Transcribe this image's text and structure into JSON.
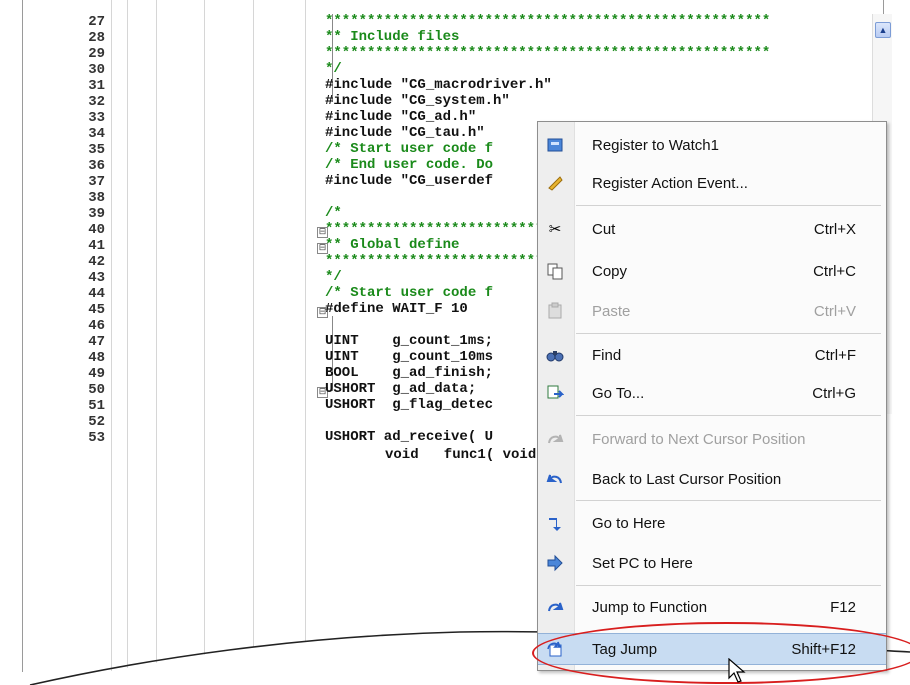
{
  "editor": {
    "line_numbers": [
      "27",
      "28",
      "29",
      "30",
      "31",
      "32",
      "33",
      "34",
      "35",
      "36",
      "37",
      "38",
      "39",
      "40",
      "41",
      "42",
      "43",
      "44",
      "45",
      "46",
      "47",
      "48",
      "49",
      "50",
      "51",
      "52",
      "53"
    ],
    "code_lines": [
      "*****************************************************",
      "** Include files",
      "*****************************************************",
      "*/",
      "#include \"CG_macrodriver.h\"",
      "#include \"CG_system.h\"",
      "#include \"CG_ad.h\"",
      "#include \"CG_tau.h\"",
      "/* Start user code f",
      "/* End user code. Do",
      "#include \"CG_userdef",
      "",
      "/*",
      "*****************************************************",
      "** Global define",
      "*****************************************************",
      "*/",
      "/* Start user code f",
      "#define WAIT_F 10",
      "",
      "UINT    g_count_1ms;",
      "UINT    g_count_10ms",
      "BOOL    g_ad_finish;",
      "USHORT  g_ad_data;",
      "USHORT  g_flag_detec",
      "",
      "USHORT ad_receive( U"
    ],
    "fold_marks": [
      "⊟",
      "⊟",
      "⊟",
      "⊟"
    ],
    "clipped_line": "void   func1( void"
  },
  "context_menu": {
    "items": [
      {
        "label": "Register to Watch1",
        "shortcut": "",
        "icon": "watch-register-icon",
        "enabled": true
      },
      {
        "label": "Register Action Event...",
        "shortcut": "",
        "icon": "action-event-icon",
        "enabled": true
      },
      {
        "label": "Cut",
        "shortcut": "Ctrl+X",
        "icon": "scissors-icon",
        "enabled": true
      },
      {
        "label": "Copy",
        "shortcut": "Ctrl+C",
        "icon": "copy-icon",
        "enabled": true
      },
      {
        "label": "Paste",
        "shortcut": "Ctrl+V",
        "icon": "paste-icon",
        "enabled": false
      },
      {
        "label": "Find",
        "shortcut": "Ctrl+F",
        "icon": "binoculars-icon",
        "enabled": true
      },
      {
        "label": "Go To...",
        "shortcut": "Ctrl+G",
        "icon": "goto-icon",
        "enabled": true
      },
      {
        "label": "Forward to Next Cursor Position",
        "shortcut": "",
        "icon": "forward-arrow-icon",
        "enabled": false
      },
      {
        "label": "Back to Last Cursor Position",
        "shortcut": "",
        "icon": "back-arrow-icon",
        "enabled": true
      },
      {
        "label": "Go to Here",
        "shortcut": "",
        "icon": "go-here-icon",
        "enabled": true
      },
      {
        "label": "Set PC to Here",
        "shortcut": "",
        "icon": "set-pc-icon",
        "enabled": true
      },
      {
        "label": "Jump to Function",
        "shortcut": "F12",
        "icon": "jump-function-icon",
        "enabled": true
      },
      {
        "label": "Tag Jump",
        "shortcut": "Shift+F12",
        "icon": "tag-jump-icon",
        "enabled": true,
        "highlighted": true
      }
    ]
  },
  "colors": {
    "comment_green": "#1a8a1a",
    "highlight": "#c8dcf2",
    "callout_red": "#d81e1e"
  }
}
